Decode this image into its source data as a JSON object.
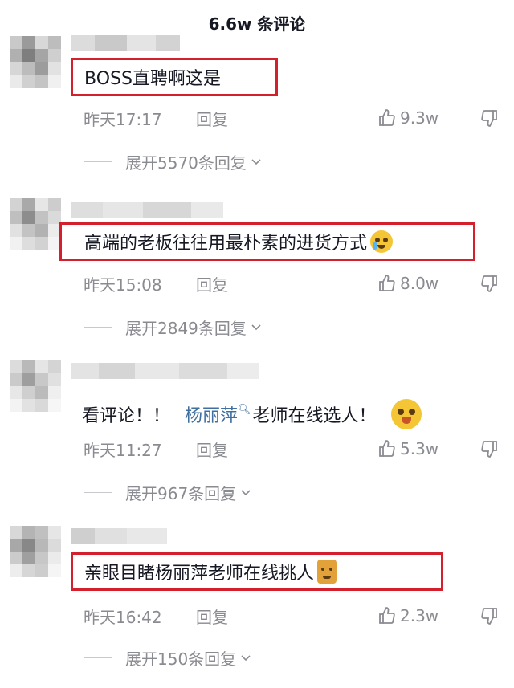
{
  "header": {
    "title": "6.6w 条评论"
  },
  "comments": [
    {
      "text": "BOSS直聘啊这是",
      "time": "昨天17:17",
      "reply_label": "回复",
      "likes": "9.3w",
      "expand_label": "展开5570条回复"
    },
    {
      "text": "高端的老板往往用最朴素的进货方式",
      "emoji": "crying-face-icon",
      "time": "昨天15:08",
      "reply_label": "回复",
      "likes": "8.0w",
      "expand_label": "展开2849条回复"
    },
    {
      "text_before": "看评论！！",
      "mention": "杨丽萍",
      "text_after": "老师在线选人！",
      "emoji": "pleading-face-icon",
      "time": "昨天11:27",
      "reply_label": "回复",
      "likes": "5.3w",
      "expand_label": "展开967条回复"
    },
    {
      "text": "亲眼目睹杨丽萍老师在线挑人",
      "emoji": "cat-icon",
      "time": "昨天16:42",
      "reply_label": "回复",
      "likes": "2.3w",
      "expand_label": "展开150条回复"
    }
  ],
  "colors": {
    "highlight_border": "#d4202c",
    "meta_gray": "#8a8b91",
    "mention_blue": "#3f6fa0"
  }
}
